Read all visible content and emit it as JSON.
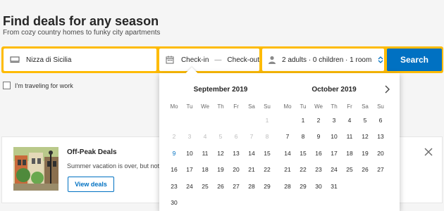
{
  "header": {
    "title": "Find deals for any season",
    "subtitle": "From cozy country homes to funky city apartments"
  },
  "search": {
    "destination": "Nizza di Sicilia",
    "checkin": "Check-in",
    "separator": "—",
    "checkout": "Check-out",
    "guests": "2 adults · 0 children · 1 room",
    "button": "Search"
  },
  "work_checkbox": {
    "label": "I'm traveling for work",
    "checked": false
  },
  "promo": {
    "title": "Off-Peak Deals",
    "text": "Summer vacation is over, but not t",
    "button": "View deals"
  },
  "calendar": {
    "weekdays": [
      "Mo",
      "Tu",
      "We",
      "Th",
      "Fr",
      "Sa",
      "Su"
    ],
    "months": [
      {
        "label": "September 2019",
        "leading_blanks": 6,
        "days": 30,
        "disabled_through": 8,
        "today": 9
      },
      {
        "label": "October 2019",
        "leading_blanks": 1,
        "days": 31,
        "disabled_through": 0,
        "today": 0
      }
    ]
  },
  "colors": {
    "accent_yellow": "#febb02",
    "brand_blue": "#0071c2",
    "disabled_text": "#bdbdbd"
  },
  "icons": {
    "destination": "bed-icon",
    "dates": "calendar-icon",
    "guests": "person-icon",
    "guests_toggle": "chevron-updown-icon",
    "next_month": "chevron-right-icon",
    "close": "close-icon"
  }
}
